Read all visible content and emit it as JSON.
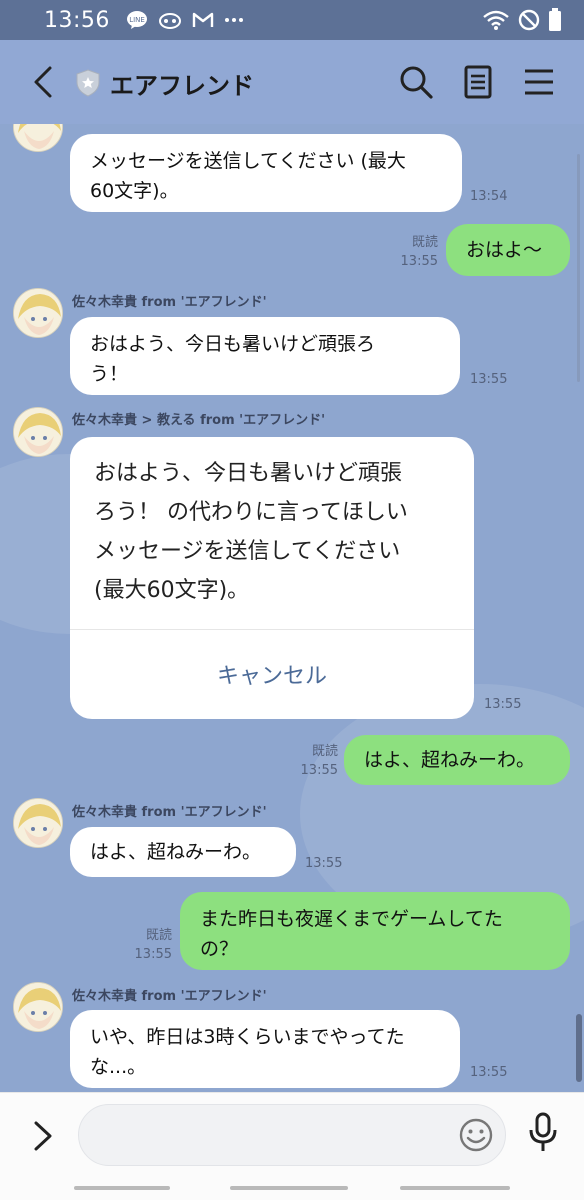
{
  "status_bar": {
    "time": "13:56",
    "icons": [
      "line-icon",
      "app-icon",
      "gmail-icon",
      "more-dots-icon",
      "wifi-icon",
      "dnd-icon",
      "battery-icon"
    ]
  },
  "header": {
    "title": "エアフレンド",
    "icons": [
      "back-icon",
      "official-shield-icon",
      "search-icon",
      "notes-icon",
      "menu-icon"
    ]
  },
  "messages": [
    {
      "kind": "incoming",
      "text": "メッセージを送信してください (最大\n60文字)。",
      "time": "13:54"
    },
    {
      "kind": "outgoing",
      "read": "既読",
      "time": "13:55",
      "text": "おはよ〜"
    },
    {
      "kind": "incoming",
      "sender": "佐々木幸貴 from 'エアフレンド'",
      "text": "おはよう、今日も暑いけど頑張ろ\nう！",
      "time": "13:55"
    },
    {
      "kind": "incoming-card",
      "sender": "佐々木幸貴 > 教える from 'エアフレンド'",
      "text": "おはよう、今日も暑いけど頑張\nろう！ の代わりに言ってほしい\nメッセージを送信してください\n(最大60文字)。",
      "cancel": "キャンセル",
      "time": "13:55"
    },
    {
      "kind": "outgoing",
      "read": "既読",
      "time": "13:55",
      "text": "はよ、超ねみーわ。"
    },
    {
      "kind": "incoming",
      "sender": "佐々木幸貴 from 'エアフレンド'",
      "text": "はよ、超ねみーわ。",
      "time": "13:55"
    },
    {
      "kind": "outgoing",
      "read": "既読",
      "time": "13:55",
      "text": "また昨日も夜遅くまでゲームしてた\nの？"
    },
    {
      "kind": "incoming",
      "sender": "佐々木幸貴 from 'エアフレンド'",
      "text": "いや、昨日は3時くらいまでやってた\nな...。",
      "time": "13:55"
    }
  ],
  "input_bar": {
    "placeholder": "",
    "icons": [
      "expand-icon",
      "emoji-icon",
      "microphone-icon"
    ]
  },
  "colors": {
    "chat_background": "#8ea6cf",
    "outgoing_bubble": "#8de07f",
    "incoming_bubble": "#ffffff",
    "status_bar": "#5d7196"
  }
}
